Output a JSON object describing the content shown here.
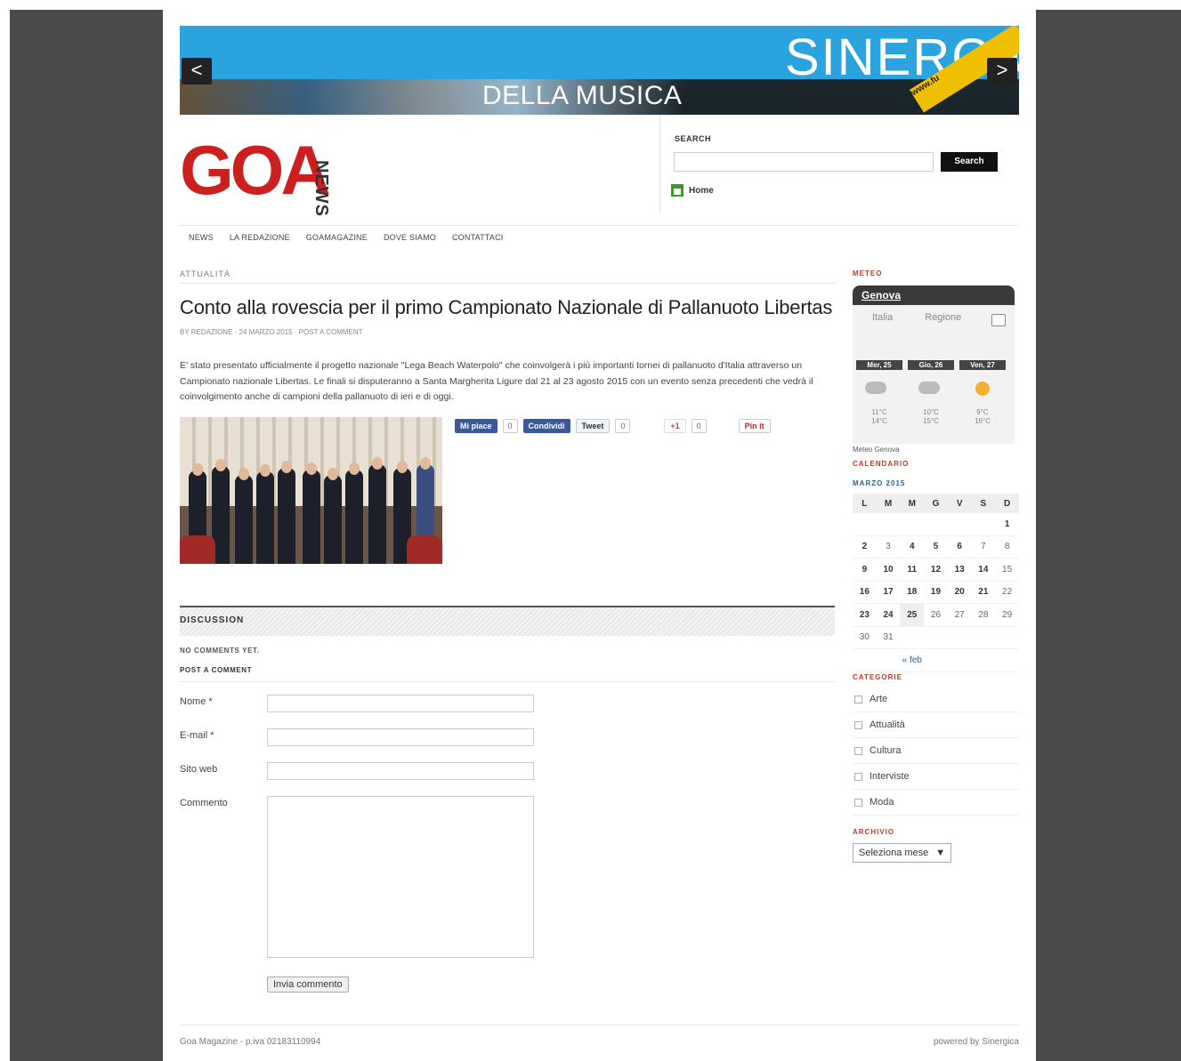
{
  "banner": {
    "prev": "<",
    "next": ">",
    "caption": "DELLA MUSICA",
    "brand": "SINERGICA",
    "url": "www.fu"
  },
  "logo": {
    "main": "GOA",
    "side": "NEWS"
  },
  "search": {
    "label": "SEARCH",
    "value": "",
    "button": "Search"
  },
  "home_link": "Home",
  "nav": [
    "NEWS",
    "LA REDAZIONE",
    "GOAMAGAZINE",
    "DOVE SIAMO",
    "CONTATTACI"
  ],
  "article": {
    "category": "ATTUALITÀ",
    "title": "Conto alla rovescia per il primo Campionato Nazionale di Pallanuoto Libertas",
    "meta": "BY REDAZIONE · 24 MARZO 2015 · POST A COMMENT",
    "body": "E' stato presentato ufficialmente il progetto nazionale \"Lega Beach Waterpolo\" che coinvolgerà i più importanti tornei di pallanuoto d'Italia attraverso un Campionato nazionale Libertas. Le finali si disputeranno a Santa Margherita Ligure dal 21 al 23 agosto 2015 con un evento senza precedenti che vedrà il coinvolgimento anche di campioni della pallanuoto di ieri e di oggi."
  },
  "share": {
    "like_label": "Mi piace",
    "like_count": "0",
    "share_label": "Condividi",
    "tweet_label": "Tweet",
    "tweet_count": "0",
    "gplus_label": "+1",
    "gplus_count": "0",
    "pin_label": "Pin it"
  },
  "discussion": {
    "title": "DISCUSSION",
    "no_comments": "NO COMMENTS YET.",
    "post_comment": "POST A COMMENT",
    "name_label": "Nome *",
    "email_label": "E-mail *",
    "site_label": "Sito web",
    "comment_label": "Commento",
    "submit": "Invia commento"
  },
  "footer": {
    "left": "Goa Magazine - p.iva 02183110994",
    "right": "powered by Sinergica"
  },
  "sidebar": {
    "meteo": {
      "heading": "METEO",
      "city": "Genova",
      "tabs": [
        "Italia",
        "Regione"
      ],
      "days": [
        "Mer, 25",
        "Gio, 26",
        "Ven, 27"
      ],
      "temps": [
        [
          "11°C",
          "14°C"
        ],
        [
          "10°C",
          "15°C"
        ],
        [
          "9°C",
          "16°C"
        ]
      ],
      "footer": "Meteo Genova"
    },
    "calendar": {
      "heading": "CALENDARIO",
      "month": "MARZO 2015",
      "weekdays": [
        "L",
        "M",
        "M",
        "G",
        "V",
        "S",
        "D"
      ],
      "weeks": [
        [
          "",
          "",
          "",
          "",
          "",
          "",
          "1"
        ],
        [
          "2",
          "3",
          "4",
          "5",
          "6",
          "7",
          "8"
        ],
        [
          "9",
          "10",
          "11",
          "12",
          "13",
          "14",
          "15"
        ],
        [
          "16",
          "17",
          "18",
          "19",
          "20",
          "21",
          "22"
        ],
        [
          "23",
          "24",
          "25",
          "26",
          "27",
          "28",
          "29"
        ],
        [
          "30",
          "31",
          "",
          "",
          "",
          "",
          ""
        ]
      ],
      "prev": "« feb"
    },
    "categories": {
      "heading": "CATEGORIE",
      "items": [
        "Arte",
        "Attualità",
        "Cultura",
        "Interviste",
        "Moda"
      ]
    },
    "archive": {
      "heading": "ARCHIVIO",
      "selected": "Seleziona mese",
      "caret": "▼"
    }
  }
}
